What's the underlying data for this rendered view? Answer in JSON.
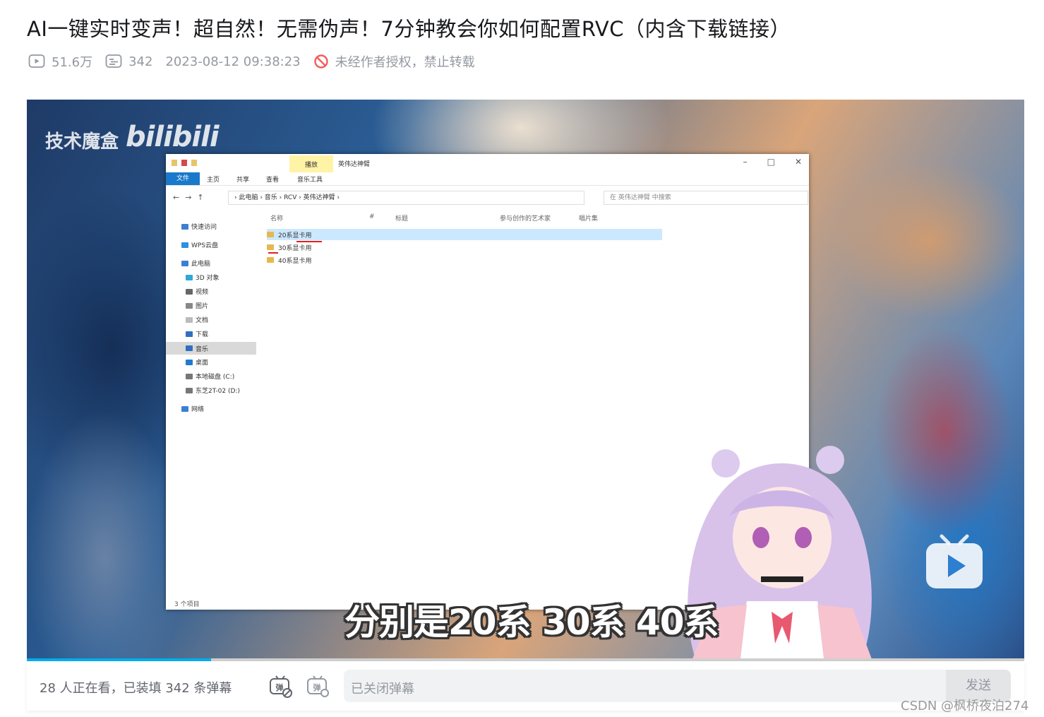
{
  "title": "AI一键实时变声！超自然！无需伪声！7分钟教会你如何配置RVC（内含下载链接）",
  "meta": {
    "views": "51.6万",
    "danmaku_count": "342",
    "datetime": "2023-08-12 09:38:23",
    "copyright_notice": "未经作者授权，禁止转载",
    "icons": [
      "play-count-icon",
      "danmaku-count-icon",
      "no-repost-icon"
    ]
  },
  "video": {
    "watermark_channel": "技术魔盒",
    "watermark_brand": "bilibili",
    "subtitle": "分别是20系 30系 40系",
    "progress": 0.185,
    "explorer": {
      "tab_play": "播放",
      "window_title": "英伟达神臂",
      "ribbon": [
        "文件",
        "主页",
        "共享",
        "查看",
        "音乐工具"
      ],
      "path": "› 此电脑 › 音乐 › RCV › 英伟达神臂 ›",
      "search_placeholder": "在 英伟达神臂 中搜索",
      "nav_items": [
        "快速访问",
        "WPS云盘",
        "此电脑",
        "3D 对象",
        "视频",
        "图片",
        "文档",
        "下载",
        "音乐",
        "桌面",
        "本地磁盘 (C:)",
        "东芝2T-02 (D:)",
        "网络"
      ],
      "columns": [
        "名称",
        "#",
        "标题",
        "参与创作的艺术家",
        "唱片集"
      ],
      "files": [
        "20系显卡用",
        "30系显卡用",
        "40系显卡用"
      ],
      "status": "3 个项目"
    }
  },
  "danmaku_bar": {
    "viewers_text": "28 人正在看，已装填 342 条弹幕",
    "input_placeholder": "已关闭弹幕",
    "send_label": "发送"
  },
  "footer_watermark": "CSDN @枫桥夜泊274"
}
